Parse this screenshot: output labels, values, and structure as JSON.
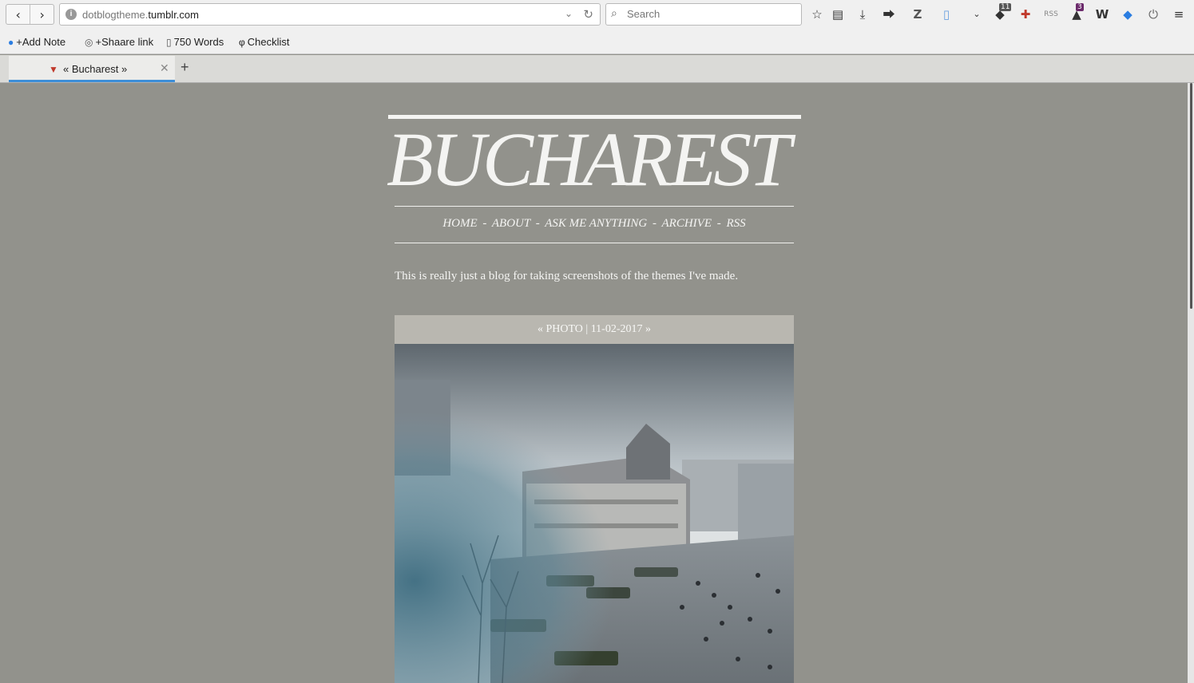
{
  "browser": {
    "url_prefix": "dotblogtheme.",
    "url_host": "tumblr.com",
    "search_placeholder": "Search",
    "badges": {
      "ext_a": "11",
      "ext_b": "3"
    },
    "bookmarks": [
      {
        "label": "+Add Note"
      },
      {
        "label": "+Shaare link"
      },
      {
        "label": "750 Words"
      },
      {
        "label": "Checklist"
      }
    ],
    "tab_title": "« Bucharest »"
  },
  "blog": {
    "title": "BUCHAREST",
    "nav": [
      {
        "label": "HOME"
      },
      {
        "label": "ABOUT"
      },
      {
        "label": "ASK ME ANYTHING"
      },
      {
        "label": "ARCHIVE"
      },
      {
        "label": "RSS"
      }
    ],
    "nav_separator": "-",
    "description": "This is really just a blog for taking screenshots of the themes I've made.",
    "post": {
      "prev": "«",
      "type": "PHOTO",
      "divider": "|",
      "date": "11-02-2017",
      "next": "»"
    }
  },
  "colors": {
    "page_bg": "#92928c",
    "post_header_bg": "#b9b7b0",
    "text": "#f4f4f2",
    "tab_accent": "#3d8ed8"
  }
}
